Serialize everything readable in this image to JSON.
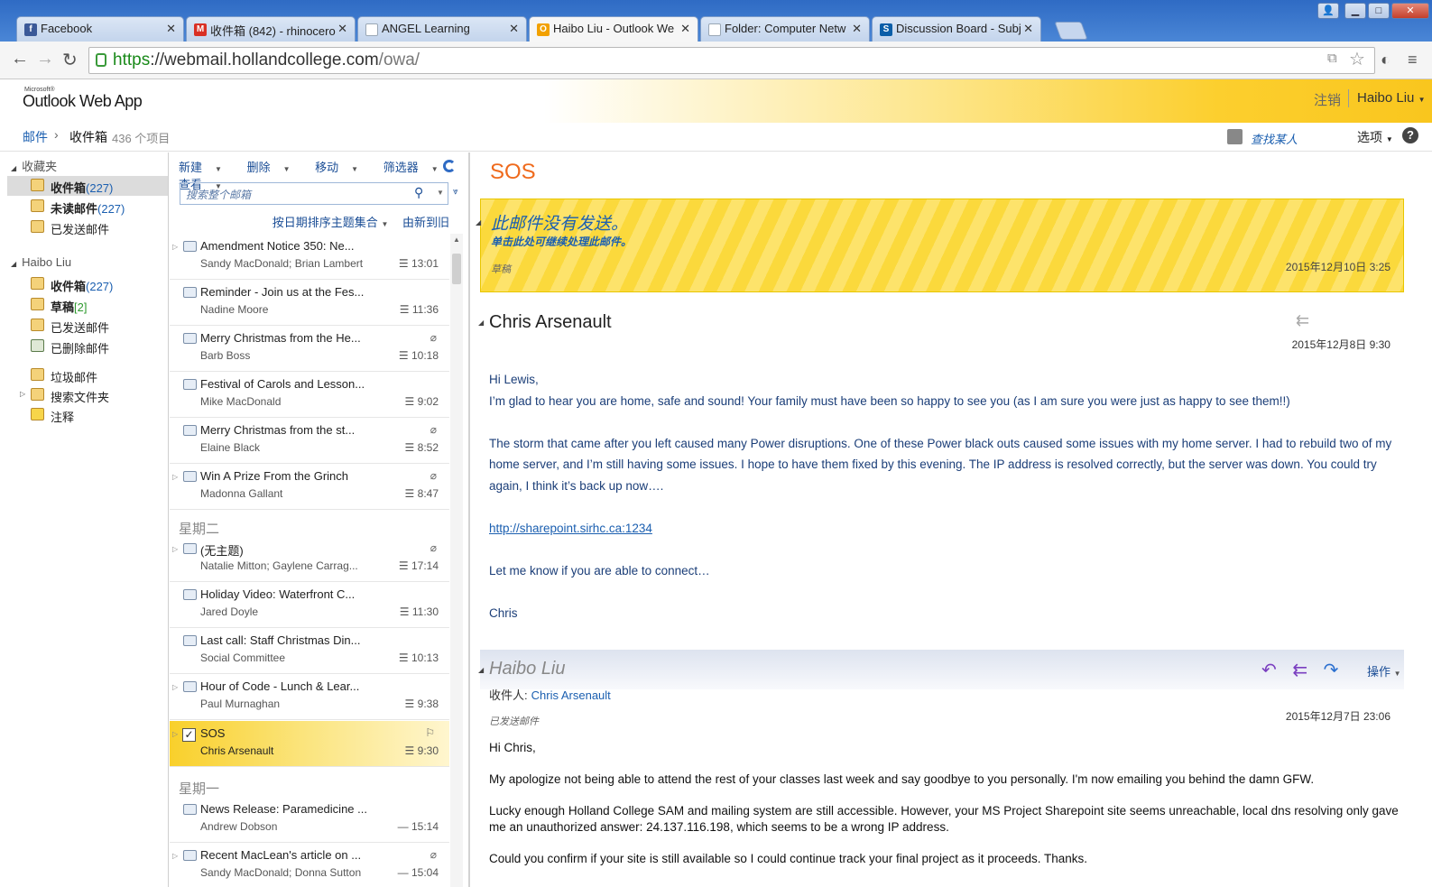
{
  "browser": {
    "tabs": [
      {
        "label": "Facebook",
        "icon": "facebook-icon",
        "color": "#3b5998",
        "glyph": "f"
      },
      {
        "label": "收件箱 (842) - rhinocero",
        "icon": "gmail-icon",
        "color": "#d93025",
        "glyph": "M"
      },
      {
        "label": "ANGEL Learning",
        "icon": "page-icon",
        "color": "#9aa7b5",
        "glyph": ""
      },
      {
        "label": "Haibo Liu - Outlook We",
        "icon": "outlook-icon",
        "color": "#f2a100",
        "glyph": "O"
      },
      {
        "label": "Folder: Computer Netw",
        "icon": "page-icon",
        "color": "#9aa7b5",
        "glyph": ""
      },
      {
        "label": "Discussion Board - Subj",
        "icon": "sharepoint-icon",
        "color": "#0b5ea8",
        "glyph": "S"
      }
    ],
    "url_scheme": "https",
    "url_host": "://webmail.hollandcollege.com",
    "url_path": "/owa/"
  },
  "app": {
    "ms_label": "Microsoft®",
    "logo": "Outlook Web App",
    "logout": "注销",
    "user": "Haibo Liu"
  },
  "breadcrumb": {
    "mail": "邮件",
    "folder": "收件箱",
    "count": "436 个项目",
    "find_people": "查找某人",
    "options": "选项"
  },
  "folders": {
    "favorites_label": "收藏夹",
    "favorites": [
      {
        "label": "收件箱",
        "count": "(227)",
        "selected": true,
        "bold": true
      },
      {
        "label": "未读邮件",
        "count": "(227)",
        "selected": false,
        "bold": true
      },
      {
        "label": "已发送邮件",
        "count": "",
        "selected": false,
        "bold": false
      }
    ],
    "account_label": "Haibo Liu",
    "account": [
      {
        "label": "收件箱",
        "count": "(227)",
        "bold": true
      },
      {
        "label": "草稿",
        "count": "[2]",
        "bold": true
      },
      {
        "label": "已发送邮件",
        "count": "",
        "bold": false
      },
      {
        "label": "已删除邮件",
        "count": "",
        "bold": false
      },
      {
        "label": "垃圾邮件",
        "count": "",
        "bold": false
      },
      {
        "label": "搜索文件夹",
        "count": "",
        "bold": false
      },
      {
        "label": "注释",
        "count": "",
        "bold": false
      }
    ]
  },
  "list": {
    "tools": [
      "新建",
      "删除",
      "移动",
      "筛选器",
      "查看"
    ],
    "search_placeholder": "搜索整个邮箱",
    "sort_label": "按日期排序主题集合",
    "order_label": "由新到旧",
    "groups": [
      "星期二",
      "星期一"
    ],
    "messages": [
      {
        "subject": "Amendment Notice 350: Ne...",
        "from": "Sandy MacDonald; Brian Lambert",
        "time": "13:01",
        "clip": false,
        "thread": true
      },
      {
        "subject": "Reminder - Join us at the Fes...",
        "from": "Nadine Moore",
        "time": "11:36",
        "clip": false,
        "thread": false
      },
      {
        "subject": "Merry Christmas from the He...",
        "from": "Barb Boss",
        "time": "10:18",
        "clip": true,
        "thread": false
      },
      {
        "subject": "Festival of Carols and Lesson...",
        "from": "Mike MacDonald",
        "time": "9:02",
        "clip": false,
        "thread": false
      },
      {
        "subject": "Merry Christmas from the st...",
        "from": "Elaine Black",
        "time": "8:52",
        "clip": true,
        "thread": false
      },
      {
        "subject": "Win A Prize From the Grinch",
        "from": "Madonna Gallant",
        "time": "8:47",
        "clip": true,
        "thread": true
      },
      {
        "subject": "(无主题)",
        "from": "Natalie Mitton; Gaylene Carrag...",
        "time": "17:14",
        "clip": true,
        "thread": true
      },
      {
        "subject": "Holiday Video: Waterfront C...",
        "from": "Jared Doyle",
        "time": "11:30",
        "clip": false,
        "thread": false
      },
      {
        "subject": "Last call: Staff Christmas Din...",
        "from": "Social Committee",
        "time": "10:13",
        "clip": false,
        "thread": false
      },
      {
        "subject": "Hour of Code - Lunch & Lear...",
        "from": "Paul Murnaghan",
        "time": "9:38",
        "clip": false,
        "thread": true
      },
      {
        "subject": "SOS",
        "from": "Chris Arsenault",
        "time": "9:30",
        "clip": false,
        "thread": true,
        "selected": true
      },
      {
        "subject": "News Release: Paramedicine ...",
        "from": "Andrew Dobson",
        "time": "15:14",
        "clip": false,
        "thread": false
      },
      {
        "subject": "Recent MacLean's article on ...",
        "from": "Sandy MacDonald; Donna Sutton",
        "time": "15:04",
        "clip": true,
        "thread": true
      }
    ]
  },
  "reading": {
    "title": "SOS",
    "notsent": {
      "heading": "此邮件没有发送。",
      "sub": "单击此处可继续处理此邮件。",
      "draft": "草稿",
      "time": "2015年12月10日 3:25"
    },
    "m1": {
      "sender": "Chris Arsenault",
      "date": "2015年12月8日 9:30",
      "greeting": "Hi Lewis,",
      "p1": " I’m glad to hear you are home, safe and sound!  Your family must have been so happy to see you (as I am sure you were just as happy to see them!!)",
      "p2": " The storm that came after you left caused many Power disruptions.  One of these Power black outs caused some issues with my home server.  I had to rebuild two of my home server, and I’m still having some issues.  I hope to have them fixed by this evening.  The IP address is resolved correctly, but the server was down.  You could try again, I think it’s back up now….",
      "link": "http://sharepoint.sirhc.ca:1234",
      "p3": "Let me know if you are able to connect…",
      "sign": "Chris"
    },
    "m2": {
      "sender": "Haibo Liu",
      "to_label": "收件人:",
      "to": "Chris Arsenault",
      "ops": "操作",
      "folder": "已发送邮件",
      "date": "2015年12月7日 23:06",
      "greeting": "Hi Chris,",
      "p1": "My apologize not being able to attend the rest of your classes last week and say goodbye to you personally. I'm now emailing you behind the damn GFW.",
      "p2": "Lucky enough Holland College SAM and mailing system are still accessible. However, your MS Project Sharepoint site seems unreachable, local dns resolving only gave me an unauthorized answer: 24.137.116.198, which seems to be a wrong IP address.",
      "p3": "Could you confirm if your site is still available so I could continue track your final project as it proceeds. Thanks."
    }
  }
}
